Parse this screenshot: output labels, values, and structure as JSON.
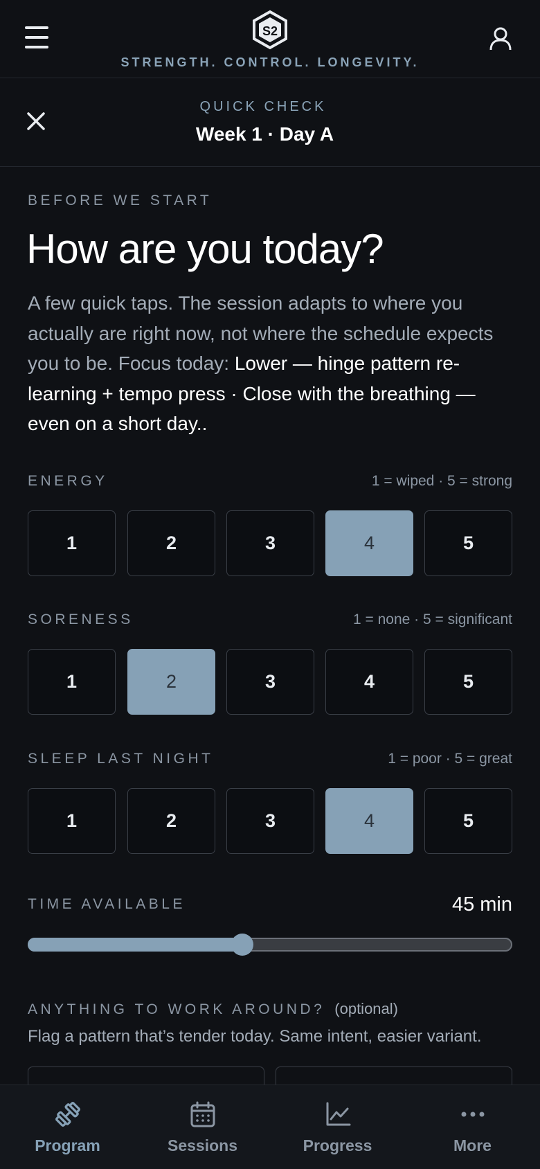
{
  "header": {
    "tagline": "STRENGTH. CONTROL. LONGEVITY.",
    "menu_icon": "hamburger-icon",
    "profile_icon": "user-icon",
    "logo_icon": "s2-logo"
  },
  "quick_check": {
    "label": "QUICK CHECK",
    "title": "Week 1 · Day A"
  },
  "intro": {
    "kicker": "BEFORE WE START",
    "headline": "How are you today?",
    "body": "A few quick taps. The session adapts to where you actually are right now, not where the schedule expects you to be. Focus today: ",
    "focus": "Lower — hinge pattern re-learning + tempo press · Close with the breathing — even on a short day.."
  },
  "ratings": [
    {
      "label": "ENERGY",
      "hint": "1 = wiped · 5 = strong",
      "options": [
        "1",
        "2",
        "3",
        "4",
        "5"
      ],
      "selected": 4
    },
    {
      "label": "SORENESS",
      "hint": "1 = none · 5 = significant",
      "options": [
        "1",
        "2",
        "3",
        "4",
        "5"
      ],
      "selected": 2
    },
    {
      "label": "SLEEP LAST NIGHT",
      "hint": "1 = poor · 5 = great",
      "options": [
        "1",
        "2",
        "3",
        "4",
        "5"
      ],
      "selected": 4
    }
  ],
  "time": {
    "label": "TIME AVAILABLE",
    "value": "45 min",
    "fraction": 0.44
  },
  "work_around": {
    "label": "ANYTHING TO WORK AROUND?",
    "optional": "(optional)",
    "sub": "Flag a pattern that’s tender today. Same intent, easier variant."
  },
  "tabs": [
    {
      "label": "Program",
      "icon": "dumbbell-icon",
      "active": true
    },
    {
      "label": "Sessions",
      "icon": "calendar-icon",
      "active": false
    },
    {
      "label": "Progress",
      "icon": "chart-icon",
      "active": false
    },
    {
      "label": "More",
      "icon": "more-icon",
      "active": false
    }
  ],
  "colors": {
    "background": "#0f1115",
    "accent": "#86a1b6",
    "muted": "#8b96a3"
  }
}
